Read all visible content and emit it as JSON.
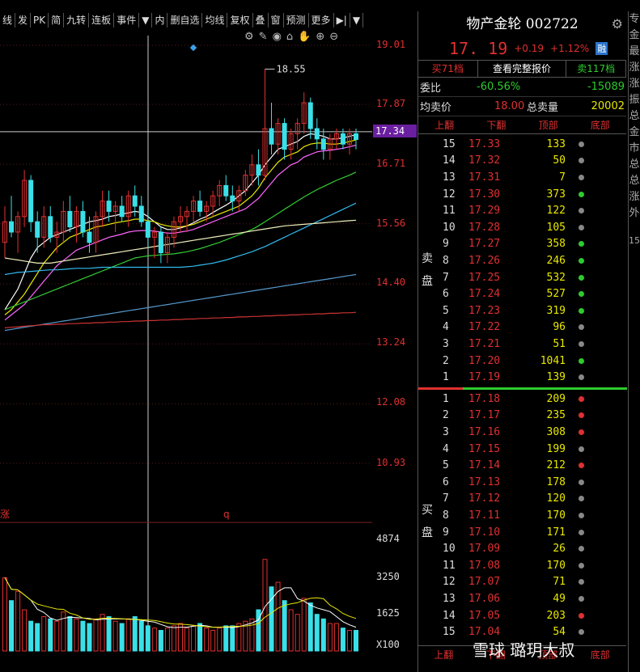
{
  "toolbar": [
    "线",
    "发",
    "PK",
    "简",
    "九转",
    "连板",
    "事件",
    "▼",
    "内",
    "删自选",
    "均线",
    "复权",
    "叠",
    "窗",
    "预测",
    "更多",
    "▶|",
    "▼"
  ],
  "chart_data": {
    "type": "candlestick",
    "price_axis": [
      "19.01",
      "17.87",
      "17.34",
      "16.71",
      "15.56",
      "14.40",
      "13.24",
      "12.08",
      "10.93"
    ],
    "volume_axis": [
      "4874",
      "3250",
      "1625",
      "X100"
    ],
    "annotation_high": "18.55",
    "current_price": "17.34",
    "label_left": "涨",
    "label_q": "q",
    "candles": [
      [
        15.2,
        15.9,
        14.9,
        15.6
      ],
      [
        15.6,
        16.1,
        15.3,
        15.4
      ],
      [
        15.4,
        15.8,
        15.0,
        15.7
      ],
      [
        15.7,
        16.6,
        15.5,
        16.4
      ],
      [
        16.4,
        16.5,
        15.4,
        15.6
      ],
      [
        15.6,
        15.8,
        15.0,
        15.3
      ],
      [
        15.3,
        15.9,
        15.1,
        15.7
      ],
      [
        15.7,
        15.9,
        15.2,
        15.3
      ],
      [
        15.3,
        15.6,
        15.0,
        15.4
      ],
      [
        15.4,
        16.0,
        15.2,
        15.8
      ],
      [
        15.8,
        16.1,
        15.4,
        15.5
      ],
      [
        15.5,
        15.9,
        15.2,
        15.8
      ],
      [
        15.8,
        16.0,
        15.3,
        15.4
      ],
      [
        15.4,
        15.7,
        15.0,
        15.2
      ],
      [
        15.2,
        15.8,
        15.0,
        15.7
      ],
      [
        15.7,
        16.2,
        15.5,
        16.0
      ],
      [
        16.0,
        16.2,
        15.6,
        15.8
      ],
      [
        15.8,
        16.0,
        15.4,
        15.9
      ],
      [
        15.9,
        16.1,
        15.6,
        15.7
      ],
      [
        15.7,
        16.2,
        15.5,
        16.1
      ],
      [
        16.1,
        16.3,
        15.7,
        15.9
      ],
      [
        15.9,
        16.1,
        15.5,
        15.6
      ],
      [
        15.6,
        15.8,
        15.1,
        15.3
      ],
      [
        15.3,
        15.5,
        14.9,
        15.4
      ],
      [
        15.4,
        15.5,
        14.8,
        15.0
      ],
      [
        15.0,
        15.4,
        14.8,
        15.3
      ],
      [
        15.3,
        15.7,
        15.1,
        15.6
      ],
      [
        15.6,
        15.9,
        15.4,
        15.7
      ],
      [
        15.7,
        15.9,
        15.4,
        15.8
      ],
      [
        15.8,
        16.1,
        15.6,
        16.0
      ],
      [
        16.0,
        16.2,
        15.7,
        15.8
      ],
      [
        15.8,
        16.0,
        15.6,
        15.9
      ],
      [
        15.9,
        16.2,
        15.7,
        16.1
      ],
      [
        16.1,
        16.4,
        15.9,
        16.3
      ],
      [
        16.3,
        16.5,
        16.0,
        16.1
      ],
      [
        16.1,
        16.3,
        15.8,
        16.0
      ],
      [
        16.0,
        16.3,
        15.8,
        16.2
      ],
      [
        16.2,
        16.6,
        16.1,
        16.5
      ],
      [
        16.5,
        16.9,
        16.3,
        16.7
      ],
      [
        16.7,
        17.0,
        16.3,
        16.5
      ],
      [
        16.5,
        18.55,
        16.4,
        17.4
      ],
      [
        17.4,
        17.9,
        16.9,
        17.1
      ],
      [
        17.1,
        17.6,
        16.9,
        17.5
      ],
      [
        17.5,
        17.6,
        16.8,
        17.0
      ],
      [
        17.0,
        17.4,
        16.8,
        17.3
      ],
      [
        17.3,
        17.6,
        17.0,
        17.5
      ],
      [
        17.5,
        18.1,
        17.3,
        17.9
      ],
      [
        17.9,
        18.0,
        17.2,
        17.4
      ],
      [
        17.4,
        17.6,
        17.0,
        17.2
      ],
      [
        17.2,
        17.4,
        16.8,
        17.0
      ],
      [
        17.0,
        17.3,
        16.8,
        17.2
      ],
      [
        17.2,
        17.4,
        17.0,
        17.3
      ],
      [
        17.3,
        17.4,
        17.0,
        17.1
      ],
      [
        17.1,
        17.4,
        16.9,
        17.3
      ],
      [
        17.3,
        17.4,
        17.0,
        17.19
      ]
    ],
    "volumes": [
      3200,
      2200,
      2600,
      1800,
      1300,
      1200,
      1500,
      1400,
      1300,
      1700,
      1500,
      1400,
      1300,
      1200,
      1400,
      1600,
      1500,
      1300,
      1200,
      1400,
      1500,
      1300,
      1100,
      1000,
      900,
      1000,
      1100,
      1200,
      1000,
      1100,
      1200,
      1000,
      900,
      1000,
      1100,
      1100,
      1200,
      1300,
      1400,
      1800,
      4000,
      2800,
      3000,
      2200,
      1800,
      1600,
      2300,
      2100,
      1600,
      1400,
      1200,
      1200,
      1000,
      900,
      900
    ],
    "ma_lines": [
      {
        "color": "#ffffff",
        "values": [
          13.9,
          14.1,
          14.3,
          14.6,
          14.9,
          15.1,
          15.2,
          15.3,
          15.35,
          15.4,
          15.45,
          15.5,
          15.55,
          15.6,
          15.62,
          15.65,
          15.7,
          15.72,
          15.75,
          15.77,
          15.8,
          15.78,
          15.7,
          15.6,
          15.5,
          15.45,
          15.45,
          15.48,
          15.52,
          15.58,
          15.65,
          15.7,
          15.78,
          15.85,
          15.92,
          16.0,
          16.1,
          16.2,
          16.35,
          16.5,
          16.7,
          16.85,
          17.0,
          17.05,
          17.1,
          17.15,
          17.25,
          17.3,
          17.28,
          17.25,
          17.2,
          17.2,
          17.22,
          17.25,
          17.28
        ]
      },
      {
        "color": "#e8e800",
        "values": [
          13.8,
          13.9,
          14.05,
          14.2,
          14.4,
          14.6,
          14.8,
          14.95,
          15.1,
          15.2,
          15.3,
          15.35,
          15.4,
          15.45,
          15.5,
          15.52,
          15.55,
          15.58,
          15.6,
          15.62,
          15.65,
          15.65,
          15.62,
          15.6,
          15.55,
          15.52,
          15.5,
          15.5,
          15.52,
          15.55,
          15.6,
          15.65,
          15.7,
          15.75,
          15.8,
          15.85,
          15.9,
          16.0,
          16.1,
          16.25,
          16.45,
          16.6,
          16.75,
          16.85,
          16.9,
          16.95,
          17.05,
          17.1,
          17.12,
          17.12,
          17.1,
          17.1,
          17.12,
          17.15,
          17.18
        ]
      },
      {
        "color": "#ff66ff",
        "values": [
          13.7,
          13.8,
          13.9,
          14.0,
          14.15,
          14.3,
          14.45,
          14.6,
          14.75,
          14.85,
          14.95,
          15.05,
          15.1,
          15.15,
          15.2,
          15.25,
          15.3,
          15.33,
          15.36,
          15.4,
          15.42,
          15.43,
          15.43,
          15.42,
          15.4,
          15.38,
          15.38,
          15.4,
          15.42,
          15.45,
          15.5,
          15.55,
          15.6,
          15.65,
          15.7,
          15.75,
          15.8,
          15.85,
          15.95,
          16.05,
          16.2,
          16.35,
          16.5,
          16.6,
          16.7,
          16.75,
          16.85,
          16.9,
          16.95,
          16.97,
          16.98,
          17.0,
          17.02,
          17.05,
          17.08
        ]
      },
      {
        "color": "#33cc33",
        "values": [
          13.9,
          13.95,
          14.0,
          14.05,
          14.1,
          14.15,
          14.2,
          14.25,
          14.3,
          14.35,
          14.4,
          14.45,
          14.5,
          14.55,
          14.6,
          14.65,
          14.7,
          14.75,
          14.8,
          14.85,
          14.9,
          14.92,
          14.94,
          14.95,
          14.96,
          14.97,
          14.98,
          15.0,
          15.02,
          15.05,
          15.08,
          15.12,
          15.16,
          15.2,
          15.25,
          15.3,
          15.35,
          15.4,
          15.45,
          15.52,
          15.6,
          15.68,
          15.76,
          15.84,
          15.92,
          16.0,
          16.08,
          16.15,
          16.22,
          16.28,
          16.34,
          16.4,
          16.45,
          16.5,
          16.56
        ]
      },
      {
        "color": "#33bbee",
        "values": [
          14.58,
          14.6,
          14.62,
          14.63,
          14.64,
          14.65,
          14.66,
          14.67,
          14.67,
          14.68,
          14.69,
          14.7,
          14.7,
          14.7,
          14.71,
          14.72,
          14.72,
          14.72,
          14.72,
          14.72,
          14.72,
          14.72,
          14.72,
          14.72,
          14.72,
          14.72,
          14.72,
          14.72,
          14.73,
          14.74,
          14.76,
          14.78,
          14.8,
          14.83,
          14.86,
          14.9,
          14.94,
          14.98,
          15.02,
          15.07,
          15.12,
          15.18,
          15.24,
          15.3,
          15.36,
          15.42,
          15.48,
          15.54,
          15.6,
          15.66,
          15.72,
          15.78,
          15.84,
          15.9,
          15.96
        ]
      },
      {
        "color": "#eeeebb",
        "values": [
          14.9,
          14.88,
          14.86,
          14.84,
          14.82,
          14.8,
          14.8,
          14.8,
          14.82,
          14.84,
          14.86,
          14.88,
          14.9,
          14.92,
          14.94,
          14.96,
          14.98,
          15.0,
          15.02,
          15.04,
          15.06,
          15.08,
          15.1,
          15.12,
          15.14,
          15.16,
          15.18,
          15.2,
          15.22,
          15.24,
          15.26,
          15.28,
          15.3,
          15.32,
          15.34,
          15.36,
          15.38,
          15.4,
          15.42,
          15.44,
          15.46,
          15.48,
          15.5,
          15.52,
          15.53,
          15.54,
          15.55,
          15.56,
          15.57,
          15.58,
          15.59,
          15.6,
          15.61,
          15.62,
          15.63
        ]
      },
      {
        "color": "#5599cc",
        "values": [
          13.5,
          13.52,
          13.54,
          13.56,
          13.58,
          13.6,
          13.62,
          13.64,
          13.66,
          13.68,
          13.7,
          13.72,
          13.74,
          13.76,
          13.78,
          13.8,
          13.82,
          13.84,
          13.86,
          13.88,
          13.9,
          13.92,
          13.94,
          13.96,
          13.98,
          14.0,
          14.02,
          14.04,
          14.06,
          14.08,
          14.1,
          14.12,
          14.14,
          14.16,
          14.18,
          14.2,
          14.22,
          14.24,
          14.26,
          14.28,
          14.3,
          14.32,
          14.34,
          14.36,
          14.38,
          14.4,
          14.42,
          14.44,
          14.46,
          14.48,
          14.5,
          14.52,
          14.54,
          14.56,
          14.58
        ]
      },
      {
        "color": "#cc3333",
        "values": [
          13.55,
          13.56,
          13.57,
          13.58,
          13.59,
          13.6,
          13.61,
          13.61,
          13.62,
          13.62,
          13.63,
          13.63,
          13.64,
          13.64,
          13.65,
          13.65,
          13.66,
          13.66,
          13.67,
          13.67,
          13.68,
          13.68,
          13.69,
          13.69,
          13.7,
          13.7,
          13.71,
          13.71,
          13.72,
          13.72,
          13.73,
          13.73,
          13.74,
          13.74,
          13.75,
          13.75,
          13.76,
          13.76,
          13.77,
          13.77,
          13.78,
          13.78,
          13.79,
          13.79,
          13.8,
          13.8,
          13.81,
          13.81,
          13.82,
          13.82,
          13.83,
          13.83,
          13.84,
          13.84,
          13.85
        ]
      }
    ]
  },
  "quote": {
    "name": "物产金轮 002722",
    "price": "17. 19",
    "change": "+0.19",
    "pct": "+1.12%",
    "badge": "融"
  },
  "buttons": {
    "buy": "买71档",
    "full": "查看完整报价",
    "sell": "卖117档"
  },
  "info": [
    {
      "k": "委比",
      "v1": "-60.56%",
      "v2": "-15089"
    },
    {
      "k": "均卖价",
      "v1": "18.00",
      "m": "总卖量",
      "v2": "20002"
    }
  ],
  "tabs": [
    "上翻",
    "下翻",
    "顶部",
    "底部"
  ],
  "side_sell": [
    "卖",
    "盘"
  ],
  "side_buy": [
    "买",
    "盘"
  ],
  "asks": [
    [
      "15",
      "17.33",
      "133",
      "#888"
    ],
    [
      "14",
      "17.32",
      "50",
      "#888"
    ],
    [
      "13",
      "17.31",
      "7",
      "#888"
    ],
    [
      "12",
      "17.30",
      "373",
      "#2dcb2d"
    ],
    [
      "11",
      "17.29",
      "122",
      "#888"
    ],
    [
      "10",
      "17.28",
      "105",
      "#888"
    ],
    [
      "9",
      "17.27",
      "358",
      "#2dcb2d"
    ],
    [
      "8",
      "17.26",
      "246",
      "#2dcb2d"
    ],
    [
      "7",
      "17.25",
      "532",
      "#2dcb2d"
    ],
    [
      "6",
      "17.24",
      "527",
      "#2dcb2d"
    ],
    [
      "5",
      "17.23",
      "319",
      "#2dcb2d"
    ],
    [
      "4",
      "17.22",
      "96",
      "#888"
    ],
    [
      "3",
      "17.21",
      "51",
      "#888"
    ],
    [
      "2",
      "17.20",
      "1041",
      "#2dcb2d"
    ],
    [
      "1",
      "17.19",
      "139",
      "#888"
    ]
  ],
  "bids": [
    [
      "1",
      "17.18",
      "209",
      "#e03030"
    ],
    [
      "2",
      "17.17",
      "235",
      "#e03030"
    ],
    [
      "3",
      "17.16",
      "308",
      "#e03030"
    ],
    [
      "4",
      "17.15",
      "199",
      "#888"
    ],
    [
      "5",
      "17.14",
      "212",
      "#e03030"
    ],
    [
      "6",
      "17.13",
      "178",
      "#888"
    ],
    [
      "7",
      "17.12",
      "120",
      "#888"
    ],
    [
      "8",
      "17.11",
      "170",
      "#888"
    ],
    [
      "9",
      "17.10",
      "171",
      "#888"
    ],
    [
      "10",
      "17.09",
      "26",
      "#888"
    ],
    [
      "11",
      "17.08",
      "170",
      "#888"
    ],
    [
      "12",
      "17.07",
      "71",
      "#888"
    ],
    [
      "13",
      "17.06",
      "49",
      "#888"
    ],
    [
      "14",
      "17.05",
      "203",
      "#e03030"
    ],
    [
      "15",
      "17.04",
      "54",
      "#888"
    ]
  ],
  "far_text": [
    "专",
    "金",
    "最",
    "涨",
    "涨",
    "振",
    "总",
    "金",
    "市",
    "总",
    "总",
    "涨",
    "外",
    "15"
  ],
  "bottom_tabs": [
    "上翻",
    "下翻",
    "顶部",
    "底部"
  ],
  "watermark": "雪球 璐玥大叔"
}
